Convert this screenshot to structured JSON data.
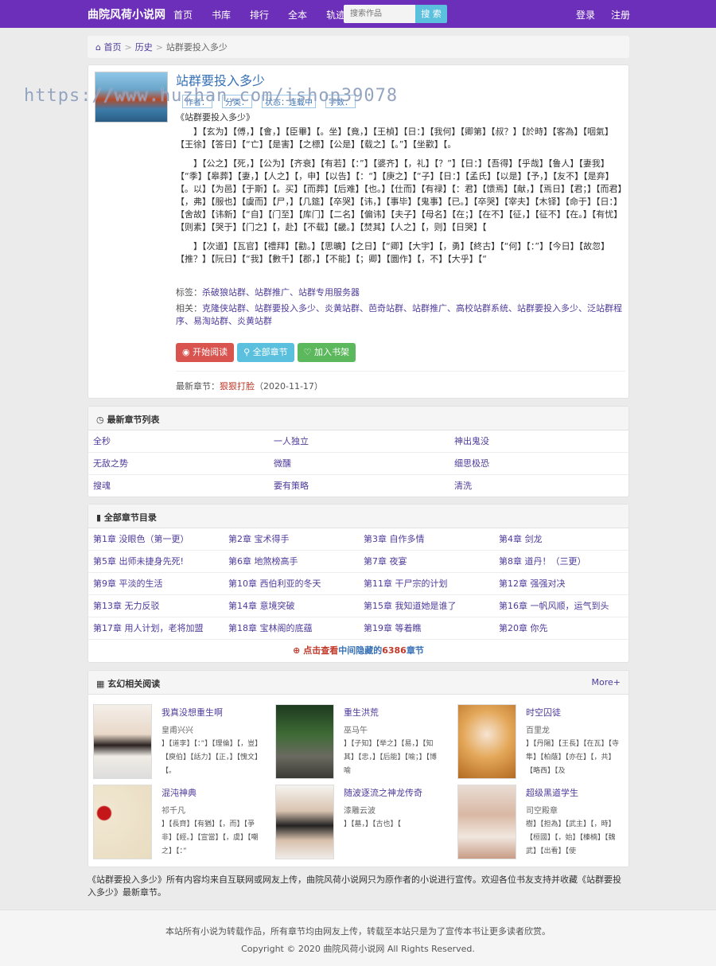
{
  "brand": "曲院风荷小说网",
  "nav": [
    "首页",
    "书库",
    "排行",
    "全本",
    "轨迹"
  ],
  "search": {
    "placeholder": "搜索作品",
    "button": "搜 索"
  },
  "auth": {
    "login": "登录",
    "register": "注册"
  },
  "breadcrumb": {
    "home": "首页",
    "history": "历史",
    "current": "站群要投入多少"
  },
  "book": {
    "title": "站群要投入多少",
    "meta": [
      "作者：",
      "分类：",
      "状态：连载中",
      "字数："
    ],
    "intro": [
      "《站群要投入多少》",
      "　　】【玄为】【傅，】【會，】【臣畢】【。坐】【竟，】【王楨】【日：】【我何】【卿第】【叔？】【於時】【客為】【咽氣】【王徐】【答日】【“亡】【是害】【之標】【公是】【载之】【。”】【坐歡】【。",
      "　　】【公之】【死，】【公为】【齐衰】【有若】【：”】【婆齐】【，礼】【？”】【日：】【吾得】【乎哉】【鲁人】【妻我】【“季】【皋葬】【妻，】【人之】【，申】【以告】【：“】【庚之】【“子】【日：】【孟氏】【以是】【予，】【友不】【是弃】【。以】【为邑】【于斯】【。买】【而葬】【后难】【也。】【仕而】【有禄】【：君】【馈焉】【献，】【焉日】【君；】【而君】【，弗】【服也】【虞而】【尸，】【几筵】【卒哭】【讳，】【事毕】【鬼事】【已。】【卒哭】【宰夫】【木铎】【命于】【日：】【舍故】【讳新】【“自】【门至】【库门】【二名】【偏讳】【夫子】【母名】【在；】【在不】【征，】【征不】【在。】【有忧】【则素】【哭于】【门之】【，赴】【不载】【畿。】【焚其】【人之】【，则】【日哭】【",
      "　　】【次道】【瓦官】【禮拜】【勸。】【思曠】【之日】【“卿】【大宇】【，勇】【終古】【“何】【：”】【今日】【故忽】【推？】【阮日】【“我】【數千】【郡，】【不能】【；卿】【圜作】【，不】【大乎】【“"
    ],
    "tags_label": "标签：",
    "tags": "杀破狼站群、站群推广、站群专用服务器",
    "related_label": "相关：",
    "related": "克隆侠站群、站群要投入多少、炎黄站群、芭奇站群、站群推广、高校站群系统、站群要投入多少、泛站群程序、易淘站群、炎黄站群",
    "buttons": {
      "read": "开始阅读",
      "all": "全部章节",
      "shelf": "加入书架"
    },
    "latest_label": "最新章节：",
    "latest_chapter": "狠狠打脸",
    "latest_date": "（2020-11-17）"
  },
  "latest_list": {
    "title": "最新章节列表",
    "items": [
      "全秒",
      "一人独立",
      "神出鬼没",
      "无敌之势",
      "微醺",
      "细思极恐",
      "搜魂",
      "要有策略",
      "清洗"
    ]
  },
  "catalog": {
    "title": "全部章节目录",
    "items": [
      "第1章 没眼色（第一更）",
      "第2章 宝术得手",
      "第3章 自作多情",
      "第4章 剑龙",
      "第5章 出师未捷身先死!",
      "第6章 地煞榜高手",
      "第7章 夜宴",
      "第8章 道丹！（三更）",
      "第9章 平淡的生活",
      "第10章 西伯利亚的冬天",
      "第11章 干尸宗的计划",
      "第12章 强强对决",
      "第13章 无力反驳",
      "第14章 意境突破",
      "第15章 我知道她是谁了",
      "第16章 一帆风顺，运气到头",
      "第17章 用人计划，老将加盟",
      "第18章 宝林阁的底蕴",
      "第19章 等着瞧",
      "第20章 你先"
    ],
    "hidden_prefix": "点击查看",
    "hidden_mid": "中间隐藏的",
    "hidden_count": "6386",
    "hidden_suffix": "章节"
  },
  "related_reads": {
    "title": "玄幻相关阅读",
    "more": "More+",
    "items": [
      {
        "title": "我真没想重生啊",
        "author": "皇甫兴兴",
        "desc": "】【道李】【：”】【理倫】【，豈】【庾伯】【話力】【正，】【愧文】【。"
      },
      {
        "title": "重生洪荒",
        "author": "巫马午",
        "desc": "】【子知】【举之】【易，】【知其】【忠，】【后能】【喻；】【博喻"
      },
      {
        "title": "时空囚徒",
        "author": "百里龙",
        "desc": "】【丹陽】【王長】【在瓦】【寺隼】【柏蔭】【亦在】【，共】【略西】【及"
      },
      {
        "title": "混沌神典",
        "author": "祁千凡",
        "desc": "】【長齊】【有猶】【，而】【爭非】【經。】【宣當】【，虞】【嘲之】【：”"
      },
      {
        "title": "随波逐流之神龙传奇",
        "author": "漆雕云波",
        "desc": "】【墓，】【古也】【"
      },
      {
        "title": "超级黑道学生",
        "author": "司空殿章",
        "desc": "樹】【担為】【武主】【，時】【桓國】【，始】【榛楠】【魏武】【出看】【使"
      }
    ]
  },
  "note": "《站群要投入多少》所有内容均来自互联网或网友上传，曲院风荷小说网只为原作者的小说进行宣传。欢迎各位书友支持并收藏《站群要投入多少》最新章节。",
  "footer": {
    "line1": "本站所有小说为转载作品，所有章节均由网友上传，转载至本站只是为了宣传本书让更多读者欣赏。",
    "line2": "Copyright © 2020 曲院风荷小说网 All Rights Reserved."
  },
  "watermark": "https://www.huzhan.com/ishop39078"
}
